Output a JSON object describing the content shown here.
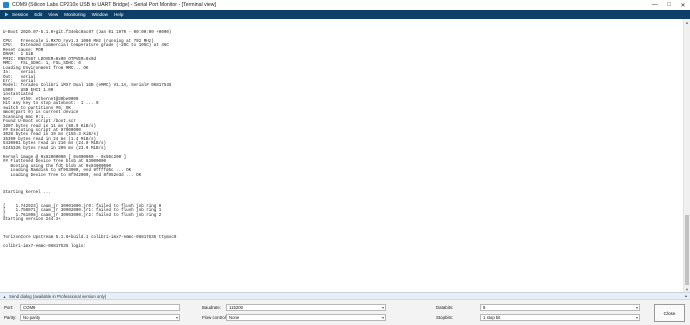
{
  "window": {
    "title": "COM9 (Silicon Labs CP210x USB to UART Bridge) - Serial Port Monitor - [Terminal view]",
    "controls": [
      "—",
      "□",
      "✕"
    ]
  },
  "menu": {
    "items": [
      "Session",
      "Edit",
      "View",
      "Monitoring",
      "Window",
      "Help"
    ]
  },
  "terminal": {
    "text": "U-Boot 2020.07-5.1.0+git.f34ebc0ac97 (Jan 01 1970 - 00:00:00 +0000)\n\nCPU:   Freescale i.MX7D rev1.3 1000 MHz (running at 792 MHz)\nCPU:   Extended Commercial temperature grade (-20C to 105C) at 46C\nReset cause: POR\nDRAM:  1 GiB\nPMIC: RN5T567 LDOVER=0x00 OTPVER=0x0d\nMMC:   FSL_SDHC: 1, FSL_SDHC: 0\nLoading Environment from MMC... OK\nIn:    serial\nOut:   serial\nErr:   serial\nModel: Toradex Colibri iMX7 Dual 1GB (eMMC) V1.1A, Serial# 06817535\nUSB0:  USB EHCI 1.00\ninstantiated\nNet:   eth0: ethernet@30be0000\nHit any key to stop autoboot:  1 ... 0\nswitch to partitions #0, OK\nmmc0(part 0) is current device\nScanning mmc 0:1...\nFound U-Boot script /boot.scr\n1007 bytes read in 11 ms (88.9 KiB/s)\n## Executing script at 87000000\n3020 bytes read in 19 ms (155.3 KiB/s)\n35390 bytes read in 24 ms (1.4 MiB/s)\n5430081 bytes read in 216 ms (24.0 MiB/s)\n5245336 bytes read in 209 ms (23.9 MiB/s)\n\nKernel image @ 0x82000000 [ 0x000000 - 0x50c200 ]\n## Flattened Device Tree blob at 83000000\n   Booting using the fdt blob at 0x83000000\n   Loading Ramdisk to 8f953000, end 8ffffd6c ... OK\n   Loading Device Tree to 8f942000, end 8f952e3d ... OK\n\n\n\nStarting kernel ...\n\n\n[    1.742923] caam_jr 30901000.jr0: failed to flush job ring 0\n[    1.750071] caam_jr 30902000.jr1: failed to flush job ring 1\n[    1.761098] caam_jr 30903000.jr2: failed to flush job ring 2\nStarting version 244.3+\n\n\n\nTorizonCore Upstream 5.1.0+build.1 colibri-imx7-emmc-06817535 ttymxc0\n\ncolibri-imx7-emmc-06817535 login:"
  },
  "send_bar": {
    "label": "Send dialog (available in Professional version only)"
  },
  "settings": {
    "port": {
      "label": "Port:",
      "value": "COM9"
    },
    "parity": {
      "label": "Parity:",
      "value": "No parity"
    },
    "baudrate": {
      "label": "Baudrate:",
      "value": "115200"
    },
    "flow_control": {
      "label": "Flow control:",
      "value": "None"
    },
    "databits": {
      "label": "Databits:",
      "value": "8"
    },
    "stopbits": {
      "label": "Stopbits:",
      "value": "1 stop bit"
    },
    "close_label": "Close"
  },
  "colors": {
    "menubar_bg": "#0e3f66",
    "menu_text": "#ffffff",
    "send_bar_bg": "#e8eef6"
  }
}
